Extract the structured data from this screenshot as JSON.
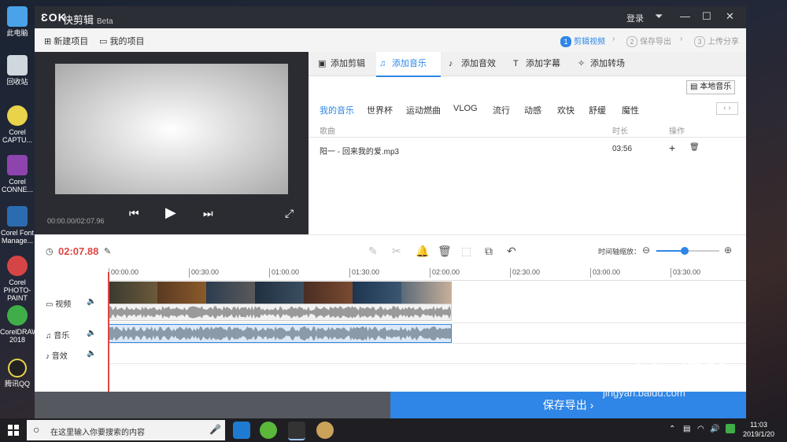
{
  "desktop": {
    "icons": [
      {
        "label": "此电脑",
        "color": "#4aa3e8"
      },
      {
        "label": "回收站",
        "color": "#cfd8dc"
      },
      {
        "label": "Corel CAPTU...",
        "color": "#e8d34a"
      },
      {
        "label": "Corel CONNE...",
        "color": "#8e44ad"
      },
      {
        "label": "Corel Font Manage...",
        "color": "#2b6cb0"
      },
      {
        "label": "Corel PHOTO-PAINT",
        "color": "#d64545"
      },
      {
        "label": "CorelDRAW 2018",
        "color": "#3fae49"
      },
      {
        "label": "腾讯QQ",
        "color": "#222222"
      }
    ]
  },
  "titlebar": {
    "logo": "ƐOK",
    "app_name": "快剪辑",
    "beta": "Beta",
    "login": "登录"
  },
  "toolbar": {
    "new_project": "新建项目",
    "my_projects": "我的项目",
    "steps": [
      {
        "num": "1",
        "label": "剪辑视频"
      },
      {
        "num": "2",
        "label": "保存导出"
      },
      {
        "num": "3",
        "label": "上传分享"
      }
    ]
  },
  "preview": {
    "timecode": "00:00.00/02:07.96"
  },
  "tabs": [
    "添加剪辑",
    "添加音乐",
    "添加音效",
    "添加字幕",
    "添加转场"
  ],
  "music": {
    "local_button": "本地音乐",
    "categories": [
      "我的音乐",
      "世界杯",
      "运动燃曲",
      "VLOG",
      "流行",
      "动感",
      "欢快",
      "舒缓",
      "魔性"
    ],
    "columns": {
      "song": "歌曲",
      "duration": "时长",
      "action": "操作"
    },
    "rows": [
      {
        "song": "阳一 - 回来我的爱.mp3",
        "duration": "03:56"
      }
    ]
  },
  "editbar": {
    "duration": "02:07.88",
    "zoom_label": "时间轴缩放：",
    "zoom_level": 0.45
  },
  "timeline": {
    "ticks": [
      "00:00.00",
      "00:30.00",
      "01:00.00",
      "01:30.00",
      "02:00.00",
      "02:30.00",
      "03:00.00",
      "03:30.00"
    ],
    "tracks": {
      "video": "视频",
      "music": "音乐",
      "sfx": "音效"
    }
  },
  "export": {
    "label": "保存导出 ›"
  },
  "taskbar": {
    "search_placeholder": "在这里输入你要搜索的内容",
    "time": "11:03",
    "date": "2019/1/20"
  },
  "watermark": {
    "brand": "Baidu经验",
    "url": "jingyan.baidu.com"
  },
  "colors": {
    "accent": "#2f86e6",
    "red": "#e04646"
  }
}
